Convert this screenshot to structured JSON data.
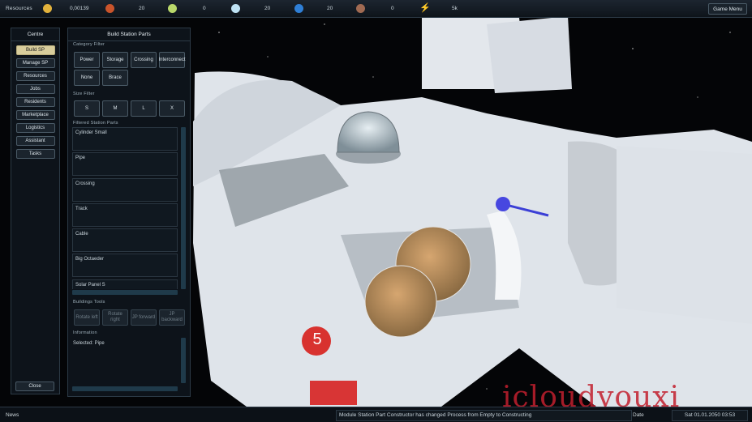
{
  "topbar": {
    "resources_label": "Resources",
    "game_menu": "Game Menu",
    "items": [
      {
        "icon": "credits-icon",
        "value": "0,00139",
        "color": "#e2b23c"
      },
      {
        "icon": "food-icon",
        "value": "20",
        "color": "#c9542b"
      },
      {
        "icon": "oxygen-icon",
        "value": "0",
        "color": "#b9d86a"
      },
      {
        "icon": "water-drop-icon",
        "value": "20",
        "color": "#bfe3f5"
      },
      {
        "icon": "fuel-icon",
        "value": "20",
        "color": "#2f7fd6"
      },
      {
        "icon": "ore-icon",
        "value": "0",
        "color": "#a06a52"
      },
      {
        "icon": "energy-icon",
        "value": "5k",
        "color": "#f0d83c"
      }
    ]
  },
  "centre": {
    "title": "Centre",
    "buttons": [
      "Build SP",
      "Manage SP",
      "Resources",
      "Jobs",
      "Residents",
      "Marketplace",
      "Logistics",
      "Assistant",
      "Tasks"
    ],
    "close": "Close"
  },
  "build": {
    "title": "Build Station Parts",
    "category_label": "Category Filter",
    "categories": [
      "Power",
      "Storage",
      "Crossing",
      "Interconnect",
      "None",
      "Brace"
    ],
    "size_label": "Size Filter",
    "sizes": [
      "S",
      "M",
      "L",
      "X"
    ],
    "filtered_label": "Filtered Station Parts",
    "parts": [
      "Cylinder Small",
      "Pipe",
      "Crossing",
      "Track",
      "Cable",
      "Big Octaeder",
      "Solar Panel S"
    ],
    "buildings_label": "Buildings Tools",
    "tools": [
      "Rotate left",
      "Rotate right",
      "JP forward",
      "JP backward"
    ],
    "info_label": "Information",
    "info_text": "Selected: Pipe"
  },
  "bottombar": {
    "news_label": "News",
    "news_module": "Module",
    "news_text": "Module Station Part Constructor has changed Process from Empty to Constructing",
    "date_label": "Date",
    "date_value": "Sat 01.01.2050 03:53"
  },
  "viewport": {
    "badge_number": "5",
    "watermark": "icloudyouxi"
  }
}
